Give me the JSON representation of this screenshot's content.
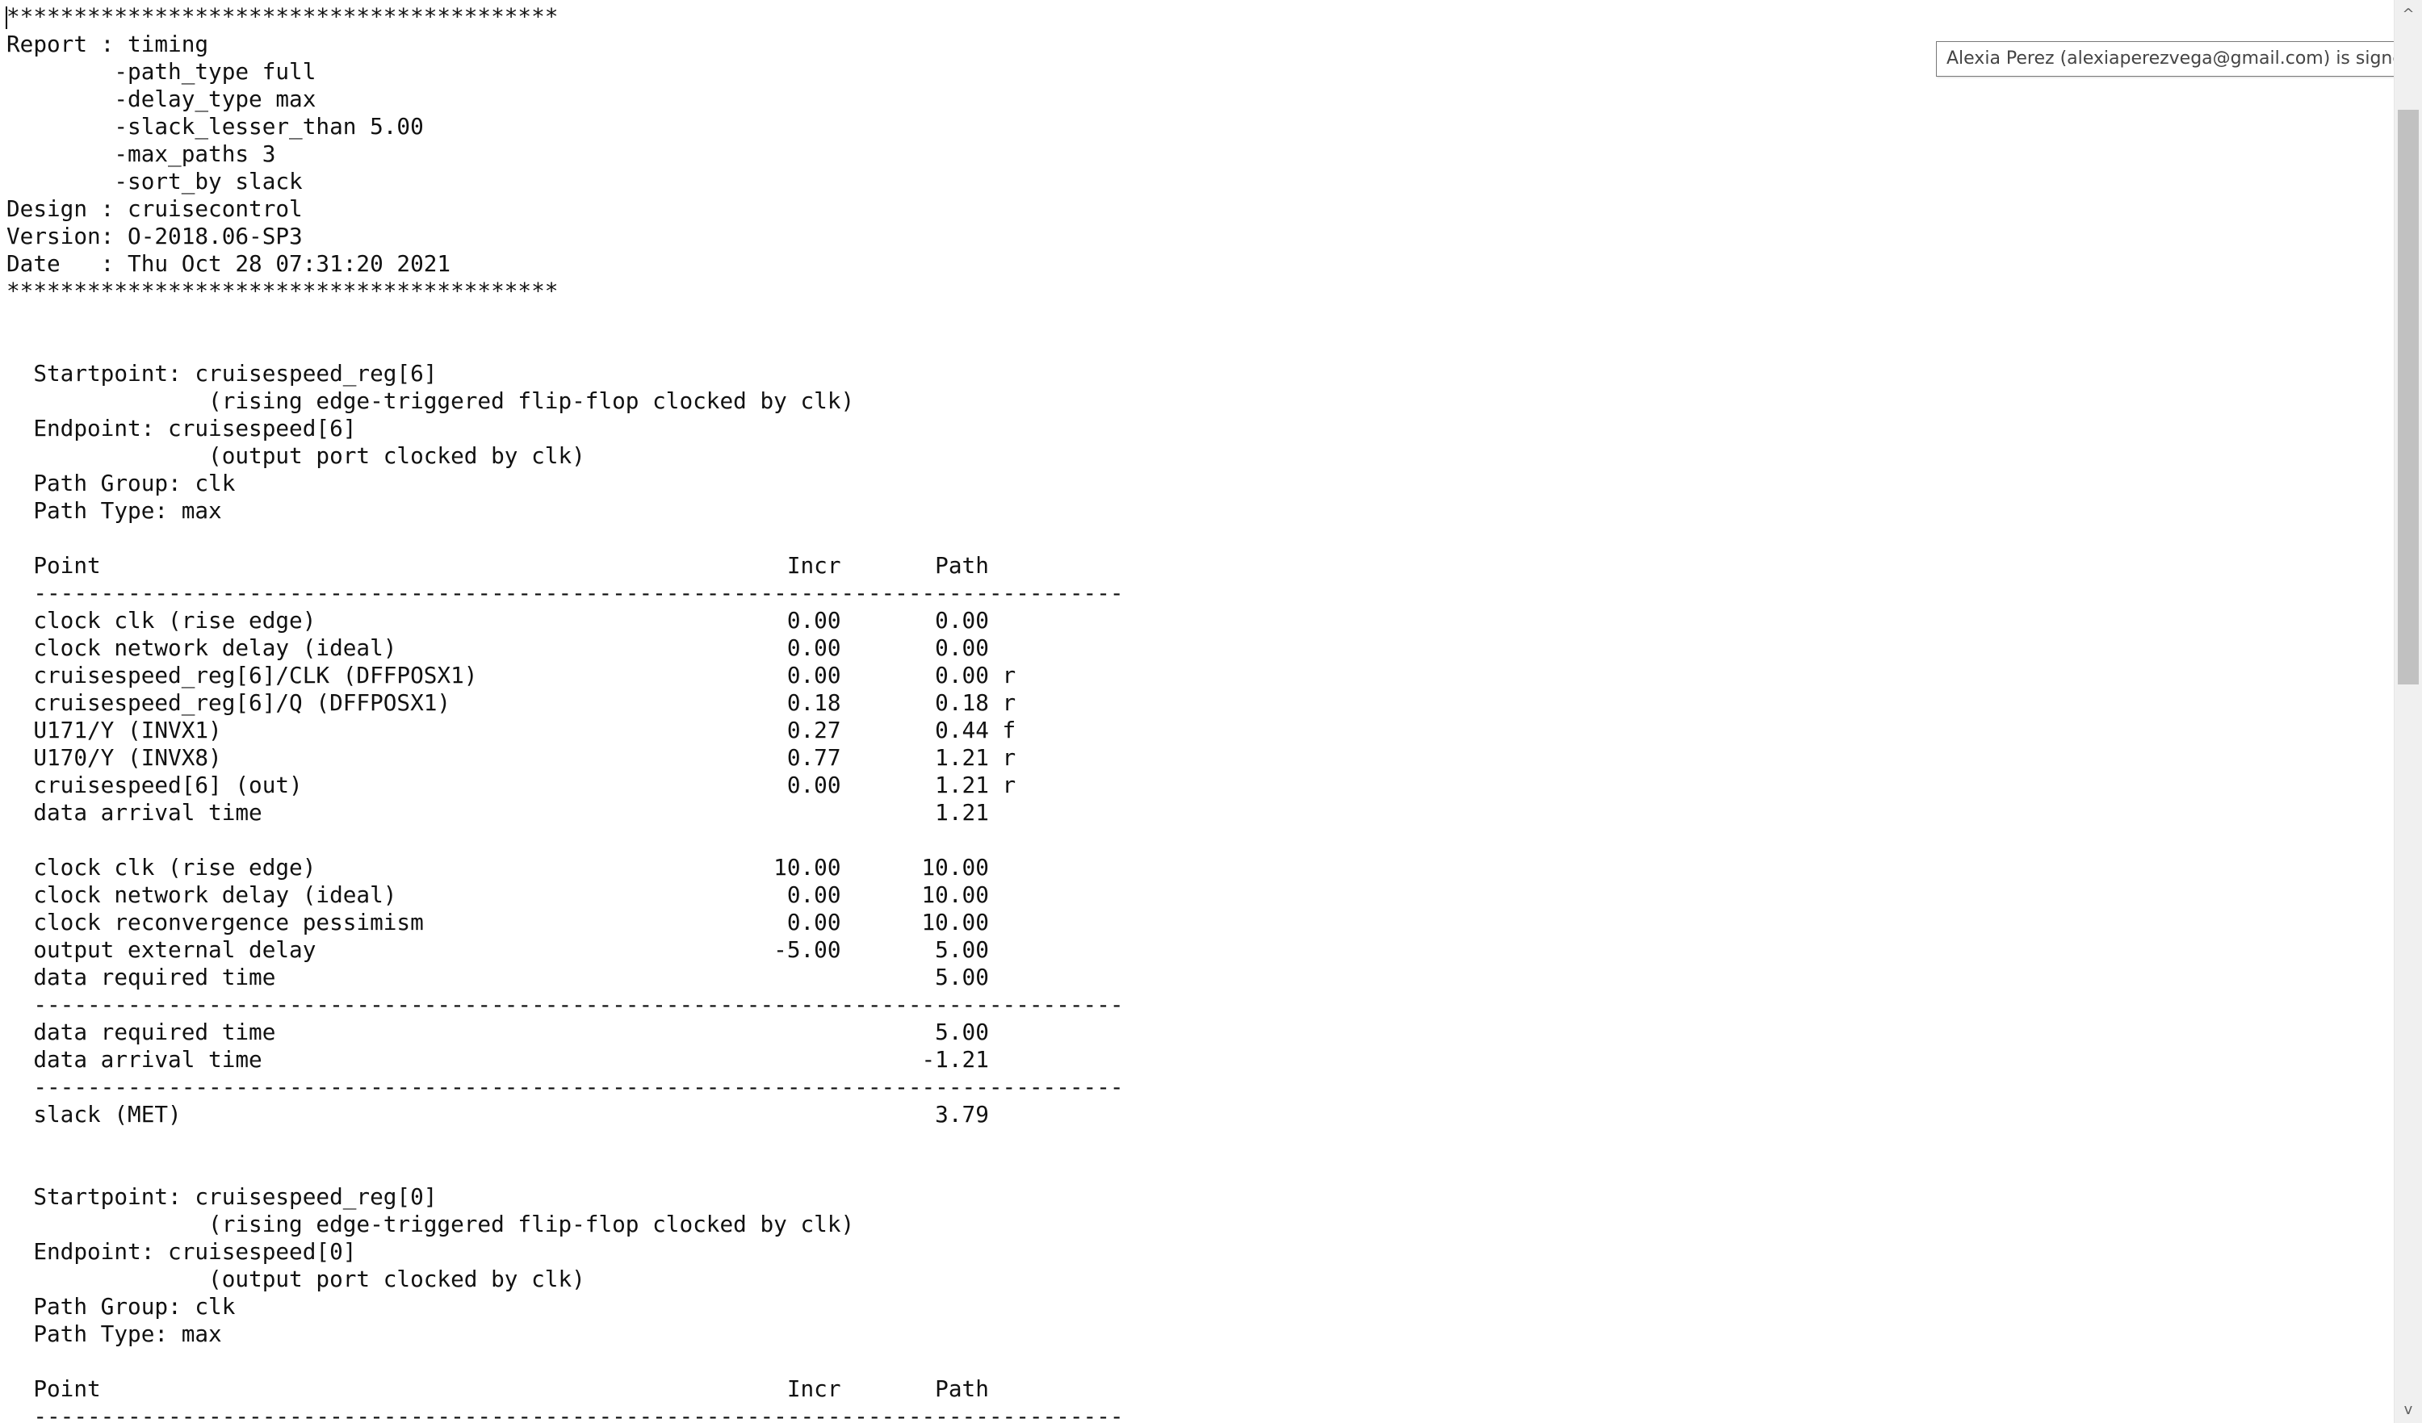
{
  "report": {
    "text": "*****************************************\nReport : timing\n        -path_type full\n        -delay_type max\n        -slack_lesser_than 5.00\n        -max_paths 3\n        -sort_by slack\nDesign : cruisecontrol\nVersion: O-2018.06-SP3\nDate   : Thu Oct 28 07:31:20 2021\n*****************************************\n\n\n  Startpoint: cruisespeed_reg[6]\n               (rising edge-triggered flip-flop clocked by clk)\n  Endpoint: cruisespeed[6]\n               (output port clocked by clk)\n  Path Group: clk\n  Path Type: max\n\n  Point                                                   Incr       Path\n  ---------------------------------------------------------------------------------\n  clock clk (rise edge)                                   0.00       0.00\n  clock network delay (ideal)                             0.00       0.00\n  cruisespeed_reg[6]/CLK (DFFPOSX1)                       0.00       0.00 r\n  cruisespeed_reg[6]/Q (DFFPOSX1)                         0.18       0.18 r\n  U171/Y (INVX1)                                          0.27       0.44 f\n  U170/Y (INVX8)                                          0.77       1.21 r\n  cruisespeed[6] (out)                                    0.00       1.21 r\n  data arrival time                                                  1.21\n\n  clock clk (rise edge)                                  10.00      10.00\n  clock network delay (ideal)                             0.00      10.00\n  clock reconvergence pessimism                           0.00      10.00\n  output external delay                                  -5.00       5.00\n  data required time                                                 5.00\n  ---------------------------------------------------------------------------------\n  data required time                                                 5.00\n  data arrival time                                                 -1.21\n  ---------------------------------------------------------------------------------\n  slack (MET)                                                        3.79\n\n\n  Startpoint: cruisespeed_reg[0]\n               (rising edge-triggered flip-flop clocked by clk)\n  Endpoint: cruisespeed[0]\n               (output port clocked by clk)\n  Path Group: clk\n  Path Type: max\n\n  Point                                                   Incr       Path\n  ---------------------------------------------------------------------------------"
  },
  "tooltip": {
    "text": "Alexia Perez (alexiaperezvega@gmail.com) is signed in"
  },
  "scrollbar": {
    "up_glyph": "^",
    "down_glyph": "v"
  }
}
